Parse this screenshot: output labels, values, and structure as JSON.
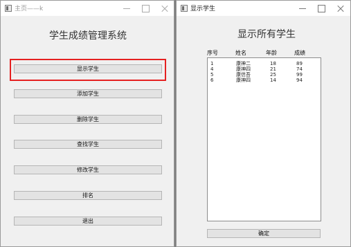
{
  "main_window": {
    "title": "主页——k",
    "heading": "学生成绩管理系统",
    "buttons": [
      "显示学生",
      "添加学生",
      "删除学生",
      "查找学生",
      "修改学生",
      "排名",
      "退出"
    ]
  },
  "list_window": {
    "title": "显示学生",
    "heading": "显示所有学生",
    "columns": [
      "序号",
      "姓名",
      "年龄",
      "成绩"
    ],
    "rows": [
      [
        "1",
        "康神二",
        "18",
        "89"
      ],
      [
        "4",
        "康神四",
        "21",
        "74"
      ],
      [
        "5",
        "康信吾",
        "25",
        "99"
      ],
      [
        "6",
        "康神四",
        "14",
        "94"
      ]
    ],
    "ok_label": "确定"
  },
  "colors": {
    "highlight": "#e52020",
    "window_bg": "#f0f0f0",
    "desktop": "#7f7f7f"
  },
  "icons": [
    "window-icon",
    "minimize-icon",
    "maximize-icon",
    "close-icon"
  ]
}
